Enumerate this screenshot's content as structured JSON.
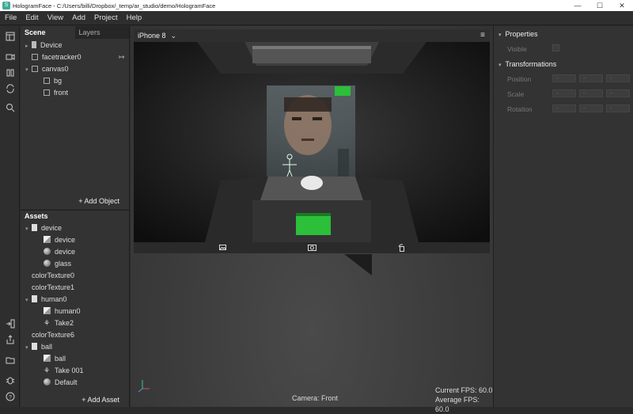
{
  "window": {
    "title": "HologramFace - C:/Users/billi/Dropbox/_temp/ar_studio/demo/HologramFace",
    "minimize": "—",
    "maximize": "☐",
    "close": "✕"
  },
  "menu": [
    "File",
    "Edit",
    "View",
    "Add",
    "Project",
    "Help"
  ],
  "scene": {
    "tab_scene": "Scene",
    "tab_layers": "Layers",
    "tree": [
      {
        "label": "Device",
        "icon": "device-icon",
        "indent": 0,
        "arrow": "▸"
      },
      {
        "label": "facetracker0",
        "icon": "facetracker-icon",
        "indent": 0,
        "arrow": ""
      },
      {
        "label": "canvas0",
        "icon": "canvas-icon",
        "indent": 0,
        "arrow": "▾"
      },
      {
        "label": "bg",
        "icon": "rectangle-icon",
        "indent": 1,
        "arrow": ""
      },
      {
        "label": "front",
        "icon": "rectangle-icon",
        "indent": 1,
        "arrow": ""
      }
    ],
    "facetracker_link": "↦",
    "add_object": "+ Add Object"
  },
  "assets": {
    "header": "Assets",
    "items": [
      {
        "label": "device",
        "icon": "file-icon",
        "indent": 0,
        "arrow": "▾"
      },
      {
        "label": "device",
        "icon": "mesh-icon",
        "indent": 1,
        "arrow": ""
      },
      {
        "label": "device",
        "icon": "material-icon",
        "indent": 1,
        "arrow": ""
      },
      {
        "label": "glass",
        "icon": "material-icon",
        "indent": 1,
        "arrow": ""
      },
      {
        "label": "colorTexture0",
        "icon": "",
        "indent": 0,
        "arrow": ""
      },
      {
        "label": "colorTexture1",
        "icon": "",
        "indent": 0,
        "arrow": ""
      },
      {
        "label": "human0",
        "icon": "file-icon",
        "indent": 0,
        "arrow": "▾"
      },
      {
        "label": "human0",
        "icon": "mesh-icon",
        "indent": 1,
        "arrow": ""
      },
      {
        "label": "Take2",
        "icon": "animation-icon",
        "indent": 1,
        "arrow": ""
      },
      {
        "label": "colorTexture6",
        "icon": "",
        "indent": 0,
        "arrow": ""
      },
      {
        "label": "ball",
        "icon": "file-icon",
        "indent": 0,
        "arrow": "▾"
      },
      {
        "label": "ball",
        "icon": "mesh-icon",
        "indent": 1,
        "arrow": ""
      },
      {
        "label": "Take 001",
        "icon": "animation-icon",
        "indent": 1,
        "arrow": ""
      },
      {
        "label": "Default",
        "icon": "material-icon",
        "indent": 1,
        "arrow": ""
      }
    ],
    "add_asset": "+ Add Asset"
  },
  "viewport": {
    "device": "iPhone 8",
    "device_caret": "⌄",
    "menu_icon": "≡",
    "camera": "Camera: Front",
    "current_fps": "Current FPS: 60.0",
    "average_fps": "Average FPS: 60.0"
  },
  "properties": {
    "header": "Properties",
    "visible_label": "Visible",
    "transform_header": "Transformations",
    "position_label": "Position",
    "scale_label": "Scale",
    "rotation_label": "Rotation",
    "field_placeholder": "-"
  },
  "colors": {
    "panel": "#333333",
    "background": "#2b2b2b",
    "accent_green": "#2bbf3a"
  }
}
